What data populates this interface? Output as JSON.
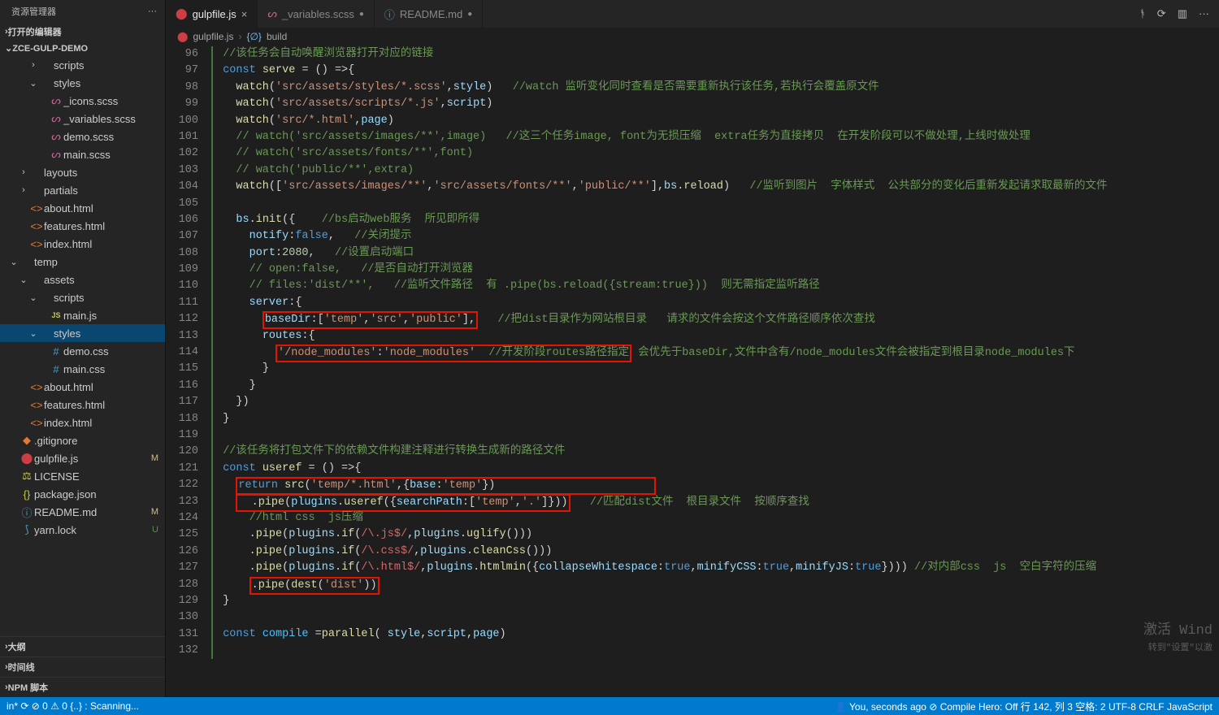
{
  "sidebar": {
    "title": "资源管理器",
    "open_editors": "打开的编辑器",
    "project": "ZCE-GULP-DEMO",
    "bottom": [
      "大纲",
      "时间线",
      "NPM 脚本"
    ],
    "tree": [
      {
        "depth": 2,
        "chev": ">",
        "icon": "folder",
        "label": "scripts"
      },
      {
        "depth": 2,
        "chev": "v",
        "icon": "folder",
        "label": "styles"
      },
      {
        "depth": 3,
        "icon": "scss",
        "label": "_icons.scss"
      },
      {
        "depth": 3,
        "icon": "scss",
        "label": "_variables.scss"
      },
      {
        "depth": 3,
        "icon": "scss",
        "label": "demo.scss"
      },
      {
        "depth": 3,
        "icon": "scss",
        "label": "main.scss"
      },
      {
        "depth": 1,
        "chev": ">",
        "icon": "folder",
        "label": "layouts"
      },
      {
        "depth": 1,
        "chev": ">",
        "icon": "folder",
        "label": "partials"
      },
      {
        "depth": 1,
        "icon": "html",
        "label": "about.html"
      },
      {
        "depth": 1,
        "icon": "html",
        "label": "features.html"
      },
      {
        "depth": 1,
        "icon": "html",
        "label": "index.html"
      },
      {
        "depth": 0,
        "chev": "v",
        "icon": "folder",
        "label": "temp"
      },
      {
        "depth": 1,
        "chev": "v",
        "icon": "folder",
        "label": "assets"
      },
      {
        "depth": 2,
        "chev": "v",
        "icon": "folder",
        "label": "scripts"
      },
      {
        "depth": 3,
        "icon": "js",
        "label": "main.js"
      },
      {
        "depth": 2,
        "chev": "v",
        "icon": "folder",
        "label": "styles",
        "selected": true
      },
      {
        "depth": 3,
        "icon": "css",
        "label": "demo.css"
      },
      {
        "depth": 3,
        "icon": "css",
        "label": "main.css"
      },
      {
        "depth": 1,
        "icon": "html",
        "label": "about.html"
      },
      {
        "depth": 1,
        "icon": "html",
        "label": "features.html"
      },
      {
        "depth": 1,
        "icon": "html",
        "label": "index.html"
      },
      {
        "depth": 0,
        "icon": "git",
        "label": ".gitignore"
      },
      {
        "depth": 0,
        "icon": "gulp",
        "label": "gulpfile.js",
        "badge": "M"
      },
      {
        "depth": 0,
        "icon": "lic",
        "label": "LICENSE"
      },
      {
        "depth": 0,
        "icon": "json",
        "label": "package.json"
      },
      {
        "depth": 0,
        "icon": "md",
        "label": "README.md",
        "badge": "M"
      },
      {
        "depth": 0,
        "icon": "yarn",
        "label": "yarn.lock",
        "badge": "U"
      }
    ]
  },
  "tabs": [
    {
      "icon": "gulp",
      "label": "gulpfile.js",
      "active": true,
      "dirty": false
    },
    {
      "icon": "scss",
      "label": "_variables.scss",
      "dirty": true
    },
    {
      "icon": "md",
      "label": "README.md",
      "dirty": true
    }
  ],
  "breadcrumb": {
    "file": "gulpfile.js",
    "symbol": "build",
    "symbol_icon": "{∅}"
  },
  "code": {
    "first_line": 96,
    "lines": [
      {
        "html": "<span class='border-left lvl0'></span>  <span class='c-cmt'>//该任务会自动唤醒浏览器打开对应的链接</span>"
      },
      {
        "html": "<span class='border-left lvl0'></span>  <span class='c-kw'>const</span> <span class='c-fn'>serve</span> <span class='c-pl'>= () =&gt;{</span>"
      },
      {
        "html": "<span class='border-left lvl0'></span>    <span class='c-fn'>watch</span><span class='c-pl'>(</span><span class='c-str'>'src/assets/styles/*.scss'</span><span class='c-pl'>,</span><span class='c-var'>style</span><span class='c-pl'>)</span>   <span class='c-cmt'>//watch 监听变化同时查看是否需要重新执行该任务,若执行会覆盖原文件</span>"
      },
      {
        "html": "<span class='border-left lvl0'></span>    <span class='c-fn'>watch</span><span class='c-pl'>(</span><span class='c-str'>'src/assets/scripts/*.js'</span><span class='c-pl'>,</span><span class='c-var'>script</span><span class='c-pl'>)</span>"
      },
      {
        "html": "<span class='border-left lvl0'></span>    <span class='c-fn'>watch</span><span class='c-pl'>(</span><span class='c-str'>'src/*.html'</span><span class='c-pl'>,</span><span class='c-var'>page</span><span class='c-pl'>)</span>"
      },
      {
        "html": "<span class='border-left lvl0'></span>    <span class='c-cmt'>// watch('src/assets/images/**',image)   //这三个任务image, font为无损压缩  extra任务为直接拷贝  在开发阶段可以不做处理,上线时做处理</span>"
      },
      {
        "html": "<span class='border-left lvl0'></span>    <span class='c-cmt'>// watch('src/assets/fonts/**',font)</span>"
      },
      {
        "html": "<span class='border-left lvl0'></span>    <span class='c-cmt'>// watch('public/**',extra)</span>"
      },
      {
        "html": "<span class='border-left lvl0'></span>    <span class='c-fn'>watch</span><span class='c-pl'>([</span><span class='c-str'>'src/assets/images/**'</span><span class='c-pl'>,</span><span class='c-str'>'src/assets/fonts/**'</span><span class='c-pl'>,</span><span class='c-str'>'public/**'</span><span class='c-pl'>],</span><span class='c-var'>bs</span><span class='c-pl'>.</span><span class='c-fn'>reload</span><span class='c-pl'>)</span>   <span class='c-cmt'>//监听到图片  字体样式  公共部分的变化后重新发起请求取最新的文件</span>"
      },
      {
        "html": "<span class='border-left lvl0'></span>"
      },
      {
        "html": "<span class='border-left lvl0'></span>    <span class='c-var'>bs</span><span class='c-pl'>.</span><span class='c-fn'>init</span><span class='c-pl'>({</span>    <span class='c-cmt'>//bs启动web服务  所见即所得</span>"
      },
      {
        "html": "<span class='border-left lvl0'></span>      <span class='c-var'>notify</span><span class='c-pl'>:</span><span class='c-kw'>false</span><span class='c-pl'>,</span>   <span class='c-cmt'>//关闭提示</span>"
      },
      {
        "html": "<span class='border-left lvl0'></span>      <span class='c-var'>port</span><span class='c-pl'>:</span><span class='c-num'>2080</span><span class='c-pl'>,</span>   <span class='c-cmt'>//设置启动端口</span>"
      },
      {
        "html": "<span class='border-left lvl0'></span>      <span class='c-cmt'>// open:false,   //是否自动打开浏览器</span>"
      },
      {
        "html": "<span class='border-left lvl0'></span>      <span class='c-cmt'>// files:'dist/**',   //监听文件路径  有 .pipe(bs.reload({stream:true}))  则无需指定监听路径</span>"
      },
      {
        "html": "<span class='border-left lvl0'></span>      <span class='c-var'>server</span><span class='c-pl'>:{</span>"
      },
      {
        "html": "<span class='border-left lvl0'></span>        <span class='hl-box'><span class='c-var'>baseDir</span><span class='c-pl'>:[</span><span class='c-str'>'temp'</span><span class='c-pl'>,</span><span class='c-str'>'src'</span><span class='c-pl'>,</span><span class='c-str'>'public'</span><span class='c-pl'>],</span></span>   <span class='c-cmt'>//把dist目录作为网站根目录   请求的文件会按这个文件路径顺序依次查找</span>"
      },
      {
        "html": "<span class='border-left lvl0'></span>        <span class='c-var'>routes</span><span class='c-pl'>:{</span>"
      },
      {
        "html": "<span class='border-left lvl0'></span>          <span class='hl-box'><span class='c-str'>'/node_modules'</span><span class='c-pl'>:</span><span class='c-str'>'node_modules'</span>  <span class='c-cmt'>//开发阶段routes路径指定</span></span> <span class='c-cmt'>会优先于baseDir,文件中含有/node_modules文件会被指定到根目录node_modules下</span>"
      },
      {
        "html": "<span class='border-left lvl0'></span>        <span class='c-pl'>}</span>"
      },
      {
        "html": "<span class='border-left lvl0'></span>      <span class='c-pl'>}</span>"
      },
      {
        "html": "<span class='border-left lvl0'></span>    <span class='c-pl'>})</span>"
      },
      {
        "html": "<span class='border-left lvl0'></span>  <span class='c-pl'>}</span>"
      },
      {
        "html": "<span class='border-left lvl0'></span>"
      },
      {
        "html": "<span class='border-left lvl0'></span>  <span class='c-cmt'>//该任务将打包文件下的依赖文件构建注释进行转换生成新的路径文件</span>"
      },
      {
        "html": "<span class='border-left lvl0'></span>  <span class='c-kw'>const</span> <span class='c-fn'>useref</span> <span class='c-pl'>= () =&gt;{</span>"
      },
      {
        "html": "<span class='border-left lvl0'></span>    <span class='hl-box'><span class='c-kw'>return</span> <span class='c-fn'>src</span><span class='c-pl'>(</span><span class='c-str'>'temp/*.html'</span><span class='c-pl'>,{</span><span class='c-var'>base</span><span class='c-pl'>:</span><span class='c-str'>'temp'</span><span class='c-pl'>})</span>                        </span>"
      },
      {
        "html": "<span class='border-left lvl0'></span>    <span class='hl-box'>  <span class='c-pl'>.</span><span class='c-fn'>pipe</span><span class='c-pl'>(</span><span class='c-var'>plugins</span><span class='c-pl'>.</span><span class='c-fn'>useref</span><span class='c-pl'>({</span><span class='c-var'>searchPath</span><span class='c-pl'>:[</span><span class='c-str'>'temp'</span><span class='c-pl'>,</span><span class='c-str'>'.'</span><span class='c-pl'>]}))</span></span>   <span class='c-cmt'>//匹配dist文件  根目录文件  按顺序查找</span>"
      },
      {
        "html": "<span class='border-left lvl0'></span>      <span class='c-cmt'>//html css  js压缩</span>"
      },
      {
        "html": "<span class='border-left lvl0'></span>      <span class='c-pl'>.</span><span class='c-fn'>pipe</span><span class='c-pl'>(</span><span class='c-var'>plugins</span><span class='c-pl'>.</span><span class='c-fn'>if</span><span class='c-pl'>(</span><span class='c-regex'>/\\.js$/</span><span class='c-pl'>,</span><span class='c-var'>plugins</span><span class='c-pl'>.</span><span class='c-fn'>uglify</span><span class='c-pl'>()))</span>"
      },
      {
        "html": "<span class='border-left lvl0'></span>      <span class='c-pl'>.</span><span class='c-fn'>pipe</span><span class='c-pl'>(</span><span class='c-var'>plugins</span><span class='c-pl'>.</span><span class='c-fn'>if</span><span class='c-pl'>(</span><span class='c-regex'>/\\.css$/</span><span class='c-pl'>,</span><span class='c-var'>plugins</span><span class='c-pl'>.</span><span class='c-fn'>cleanCss</span><span class='c-pl'>()))</span>"
      },
      {
        "html": "<span class='border-left lvl0'></span>      <span class='c-pl'>.</span><span class='c-fn'>pipe</span><span class='c-pl'>(</span><span class='c-var'>plugins</span><span class='c-pl'>.</span><span class='c-fn'>if</span><span class='c-pl'>(</span><span class='c-regex'>/\\.html$/</span><span class='c-pl'>,</span><span class='c-var'>plugins</span><span class='c-pl'>.</span><span class='c-fn'>htmlmin</span><span class='c-pl'>({</span><span class='c-var'>collapseWhitespace</span><span class='c-pl'>:</span><span class='c-kw'>true</span><span class='c-pl'>,</span><span class='c-var'>minifyCSS</span><span class='c-pl'>:</span><span class='c-kw'>true</span><span class='c-pl'>,</span><span class='c-var'>minifyJS</span><span class='c-pl'>:</span><span class='c-kw'>true</span><span class='c-pl'>})))</span> <span class='c-cmt'>//对内部css  js  空白字符的压缩</span>"
      },
      {
        "html": "<span class='border-left lvl0'></span>      <span class='hl-box'><span class='c-pl'>.</span><span class='c-fn'>pipe</span><span class='c-pl'>(</span><span class='c-fn'>dest</span><span class='c-pl'>(</span><span class='c-str'>'dist'</span><span class='c-pl'>))</span></span>"
      },
      {
        "html": "<span class='border-left lvl0'></span>  <span class='c-pl'>}</span>"
      },
      {
        "html": "<span class='border-left lvl0'></span>"
      },
      {
        "html": "<span class='border-left lvl0'></span>  <span class='c-kw'>const</span> <span class='c-const'>compile</span> <span class='c-pl'>=</span><span class='c-fn'>parallel</span><span class='c-pl'>( </span><span class='c-var'>style</span><span class='c-pl'>,</span><span class='c-var'>script</span><span class='c-pl'>,</span><span class='c-var'>page</span><span class='c-pl'>)</span>"
      },
      {
        "html": "<span class='border-left lvl0'></span>"
      }
    ]
  },
  "status": {
    "left": [
      "in*",
      "⟳",
      "⊘ 0 ⚠ 0",
      "{..} : Scanning..."
    ],
    "right": [
      "👤 You, seconds ago",
      "⊘ Compile Hero: Off",
      "行 142, 列 3",
      "空格: 2",
      "UTF-8",
      "CRLF",
      "JavaScript"
    ]
  },
  "watermark": {
    "title": "激活 Wind",
    "sub": "转到\"设置\"以激"
  }
}
